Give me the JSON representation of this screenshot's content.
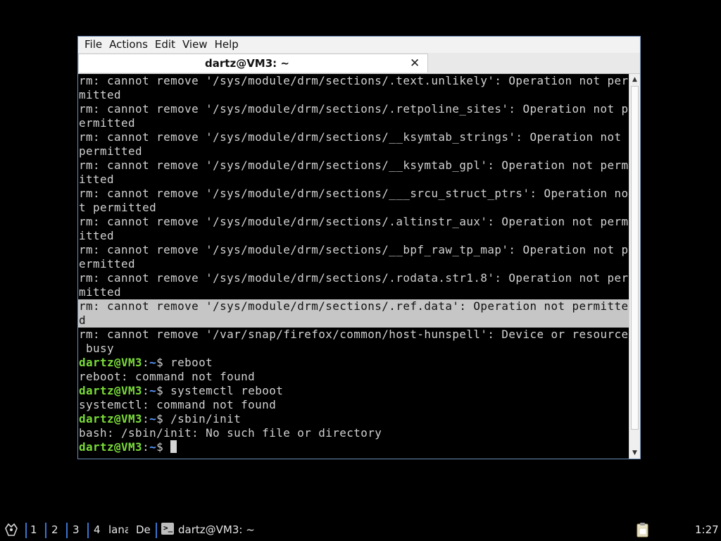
{
  "menu": [
    "File",
    "Actions",
    "Edit",
    "View",
    "Help"
  ],
  "tab": {
    "title": "dartz@VM3: ~",
    "close": "✕"
  },
  "terminal": {
    "lines": [
      {
        "text": "rm: cannot remove '/sys/module/drm/sections/.text.unlikely': Operation not per"
      },
      {
        "text": "mitted"
      },
      {
        "text": "rm: cannot remove '/sys/module/drm/sections/.retpoline_sites': Operation not p"
      },
      {
        "text": "ermitted"
      },
      {
        "text": "rm: cannot remove '/sys/module/drm/sections/__ksymtab_strings': Operation not "
      },
      {
        "text": "permitted"
      },
      {
        "text": "rm: cannot remove '/sys/module/drm/sections/__ksymtab_gpl': Operation not perm"
      },
      {
        "text": "itted"
      },
      {
        "text": "rm: cannot remove '/sys/module/drm/sections/___srcu_struct_ptrs': Operation no"
      },
      {
        "text": "t permitted"
      },
      {
        "text": "rm: cannot remove '/sys/module/drm/sections/.altinstr_aux': Operation not perm"
      },
      {
        "text": "itted"
      },
      {
        "text": "rm: cannot remove '/sys/module/drm/sections/__bpf_raw_tp_map': Operation not p"
      },
      {
        "text": "ermitted"
      },
      {
        "text": "rm: cannot remove '/sys/module/drm/sections/.rodata.str1.8': Operation not per"
      },
      {
        "text": "mitted"
      },
      {
        "text": "rm: cannot remove '/sys/module/drm/sections/.ref.data': Operation not permitte",
        "selected": true
      },
      {
        "text": "d",
        "selected": true
      },
      {
        "text": "rm: cannot remove '/var/snap/firefox/common/host-hunspell': Device or resource"
      },
      {
        "text": " busy"
      },
      {
        "prompt": {
          "user": "dartz@VM3",
          "sep": ":",
          "path": "~",
          "sym": "$ "
        },
        "cmd": "reboot"
      },
      {
        "text": "reboot: command not found"
      },
      {
        "prompt": {
          "user": "dartz@VM3",
          "sep": ":",
          "path": "~",
          "sym": "$ "
        },
        "cmd": "systemctl reboot"
      },
      {
        "text": "systemctl: command not found"
      },
      {
        "prompt": {
          "user": "dartz@VM3",
          "sep": ":",
          "path": "~",
          "sym": "$ "
        },
        "cmd": "/sbin/init"
      },
      {
        "text": "bash: /sbin/init: No such file or directory"
      },
      {
        "prompt": {
          "user": "dartz@VM3",
          "sep": ":",
          "path": "~",
          "sym": "$ "
        },
        "cmd": "",
        "cursor": true
      }
    ]
  },
  "taskbar": {
    "workspaces": [
      "1",
      "2",
      "3",
      "4"
    ],
    "items": [
      "lana",
      "De"
    ],
    "window_title": "dartz@VM3: ~",
    "clock": "1:27"
  },
  "colors": {
    "prompt_user": "#7bdc38",
    "prompt_path": "#5c9cff",
    "selection": "#c6c6c6",
    "workspace_separator": "#3a74cc"
  }
}
